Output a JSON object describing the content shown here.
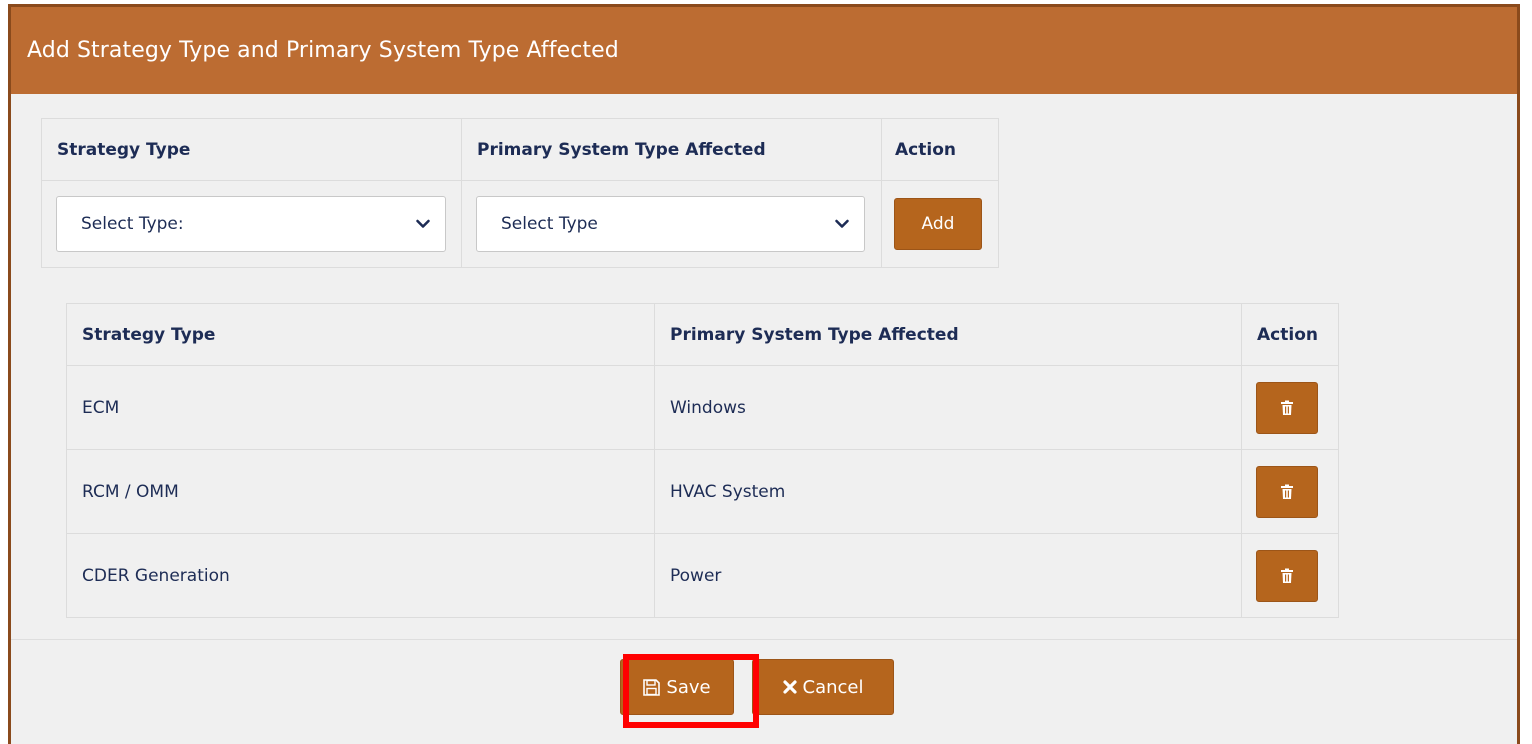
{
  "dialog": {
    "title": "Add Strategy Type and Primary System Type Affected"
  },
  "form": {
    "headers": {
      "strategy_type": "Strategy Type",
      "primary_system": "Primary System Type Affected",
      "action": "Action"
    },
    "strategy_select": {
      "selected": "Select Type:",
      "icon": "chevron-down-icon"
    },
    "system_select": {
      "selected": "Select Type",
      "icon": "chevron-down-icon"
    },
    "add_label": "Add"
  },
  "list": {
    "headers": {
      "strategy_type": "Strategy Type",
      "primary_system": "Primary System Type Affected",
      "action": "Action"
    },
    "rows": [
      {
        "strategy_type": "ECM",
        "primary_system": "Windows",
        "action_icon": "trash-icon"
      },
      {
        "strategy_type": "RCM / OMM",
        "primary_system": "HVAC System",
        "action_icon": "trash-icon"
      },
      {
        "strategy_type": "CDER Generation",
        "primary_system": "Power",
        "action_icon": "trash-icon"
      }
    ]
  },
  "footer": {
    "save_label": "Save",
    "save_icon": "floppy-disk-icon",
    "cancel_label": "Cancel",
    "cancel_icon": "close-icon"
  },
  "colors": {
    "header_bg": "#bc6c32",
    "button_bg": "#b5651d",
    "text": "#1d2c55",
    "highlight": "#ff0000"
  }
}
